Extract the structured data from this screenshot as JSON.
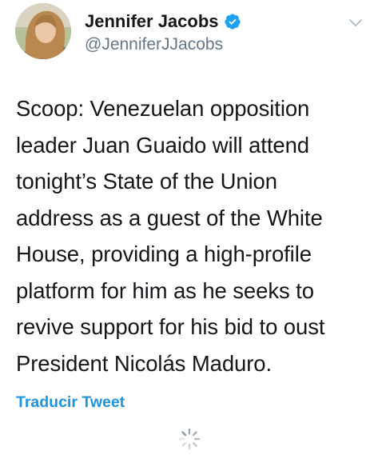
{
  "tweet": {
    "author": {
      "display_name": "Jennifer Jacobs",
      "handle": "@JenniferJJacobs",
      "verified": true
    },
    "lines": [
      "Scoop: Venezuelan opposition",
      "leader Juan Guaido will attend",
      "tonight’s State of the Union",
      "address as a guest of the White",
      "House, providing a high-profile",
      "platform for him as he seeks to",
      "revive support for his bid to oust",
      "President Nicolás Maduro."
    ],
    "translate_label": "Traducir Tweet"
  },
  "colors": {
    "text": "#14171a",
    "secondary": "#657786",
    "accent": "#1b95e0",
    "verified": "#1da1f2"
  },
  "icons": {
    "verified": "verified-badge-icon",
    "caret": "chevron-down-icon",
    "loading": "loading-spinner-icon"
  }
}
